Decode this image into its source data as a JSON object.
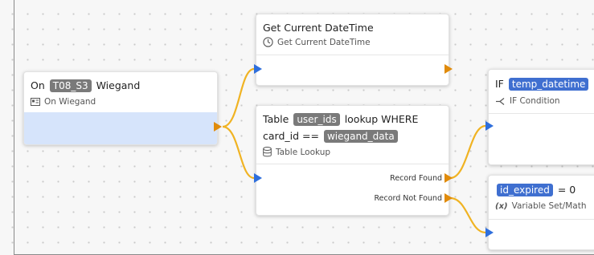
{
  "nodes": {
    "wiegand": {
      "prefix": "On",
      "pill": "T08_S3",
      "suffix": "Wiegand",
      "subtitle": "On Wiegand",
      "icon": "wiegand-event-icon"
    },
    "datetime": {
      "title": "Get Current DateTime",
      "subtitle": "Get Current DateTime",
      "icon": "clock-icon"
    },
    "lookup": {
      "line1_prefix": "Table",
      "line1_pill": "user_ids",
      "line1_suffix": "lookup WHERE",
      "line2_prefix": "card_id ==",
      "line2_pill": "wiegand_data",
      "subtitle": "Table Lookup",
      "icon": "database-icon",
      "port_found": "Record Found",
      "port_not_found": "Record Not Found"
    },
    "ifcond": {
      "prefix": "IF",
      "pill": "temp_datetime",
      "suffix": "<",
      "subtitle": "IF Condition",
      "icon": "branch-icon"
    },
    "setvar": {
      "pill": "id_expired",
      "suffix": "= 0",
      "subtitle": "Variable Set/Math",
      "icon": "variable-icon"
    }
  },
  "colors": {
    "input_arrow": "#2f6fdc",
    "output_arrow": "#e08b0b",
    "wire": "#f0b323",
    "pill_gray": "#7a7a7a",
    "pill_blue": "#3f6fd0",
    "selected_fill": "#d6e4fb"
  }
}
